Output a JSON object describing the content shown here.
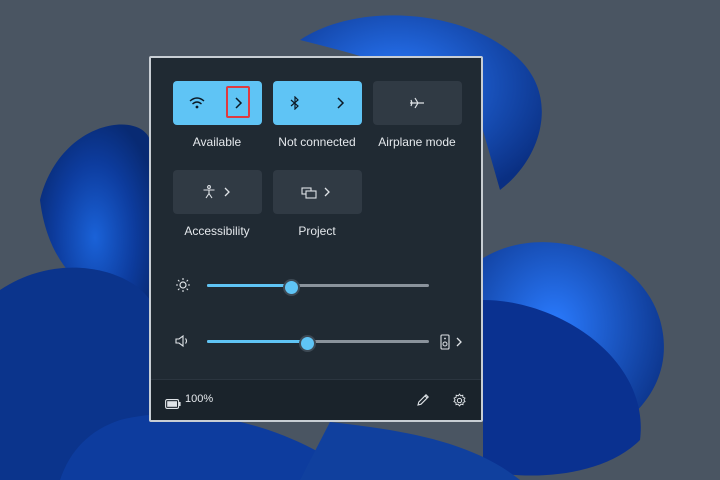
{
  "quick_settings": {
    "tiles": [
      {
        "label": "Available",
        "icon": "wifi-icon",
        "active": true,
        "has_chevron": true
      },
      {
        "label": "Not connected",
        "icon": "bluetooth-icon",
        "active": true,
        "has_chevron": true
      },
      {
        "label": "Airplane mode",
        "icon": "airplane-icon",
        "active": false,
        "has_chevron": false
      },
      {
        "label": "Accessibility",
        "icon": "accessibility-icon",
        "active": false,
        "has_chevron": true
      },
      {
        "label": "Project",
        "icon": "project-icon",
        "active": false,
        "has_chevron": true
      }
    ],
    "brightness": {
      "icon": "brightness-icon",
      "level_percent": 37
    },
    "volume": {
      "icon": "speaker-icon",
      "level_percent": 44,
      "output_icon": "audio-output-icon"
    },
    "footer": {
      "battery_text": "100%",
      "battery_icon": "battery-icon",
      "edit_icon": "pencil-icon",
      "settings_icon": "gear-icon"
    },
    "colors": {
      "accent": "#5fc4f5",
      "panel_bg": "#202a33",
      "highlight_box": "#e0393f"
    }
  }
}
